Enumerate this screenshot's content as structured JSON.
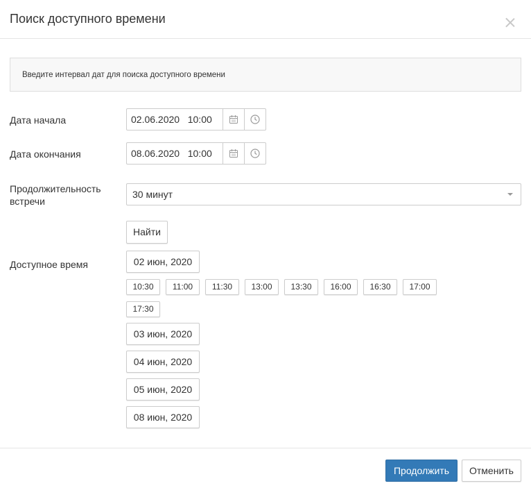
{
  "dialog": {
    "title": "Поиск доступного времени",
    "info_text": "Введите интервал дат для поиска доступного времени"
  },
  "form": {
    "start_label": "Дата начала",
    "start_value": "02.06.2020   10:00",
    "end_label": "Дата окончания",
    "end_value": "08.06.2020   10:00",
    "duration_label_line1": "Продолжительность",
    "duration_label_line2": "встречи",
    "duration_value": "30 минут",
    "find_label": "Найти",
    "available_label": "Доступное время"
  },
  "available": {
    "days": [
      {
        "date": "02 июн, 2020",
        "slots": [
          "10:30",
          "11:00",
          "11:30",
          "13:00",
          "13:30",
          "16:00",
          "16:30",
          "17:00",
          "17:30"
        ]
      },
      {
        "date": "03 июн, 2020"
      },
      {
        "date": "04 июн, 2020"
      },
      {
        "date": "05 июн, 2020"
      },
      {
        "date": "08 июн, 2020"
      }
    ]
  },
  "footer": {
    "continue_label": "Продолжить",
    "cancel_label": "Отменить"
  },
  "icons": {
    "calendar": "calendar-icon",
    "clock": "clock-icon",
    "close": "close-icon"
  },
  "colors": {
    "primary": "#337ab7",
    "border": "#cccccc"
  }
}
